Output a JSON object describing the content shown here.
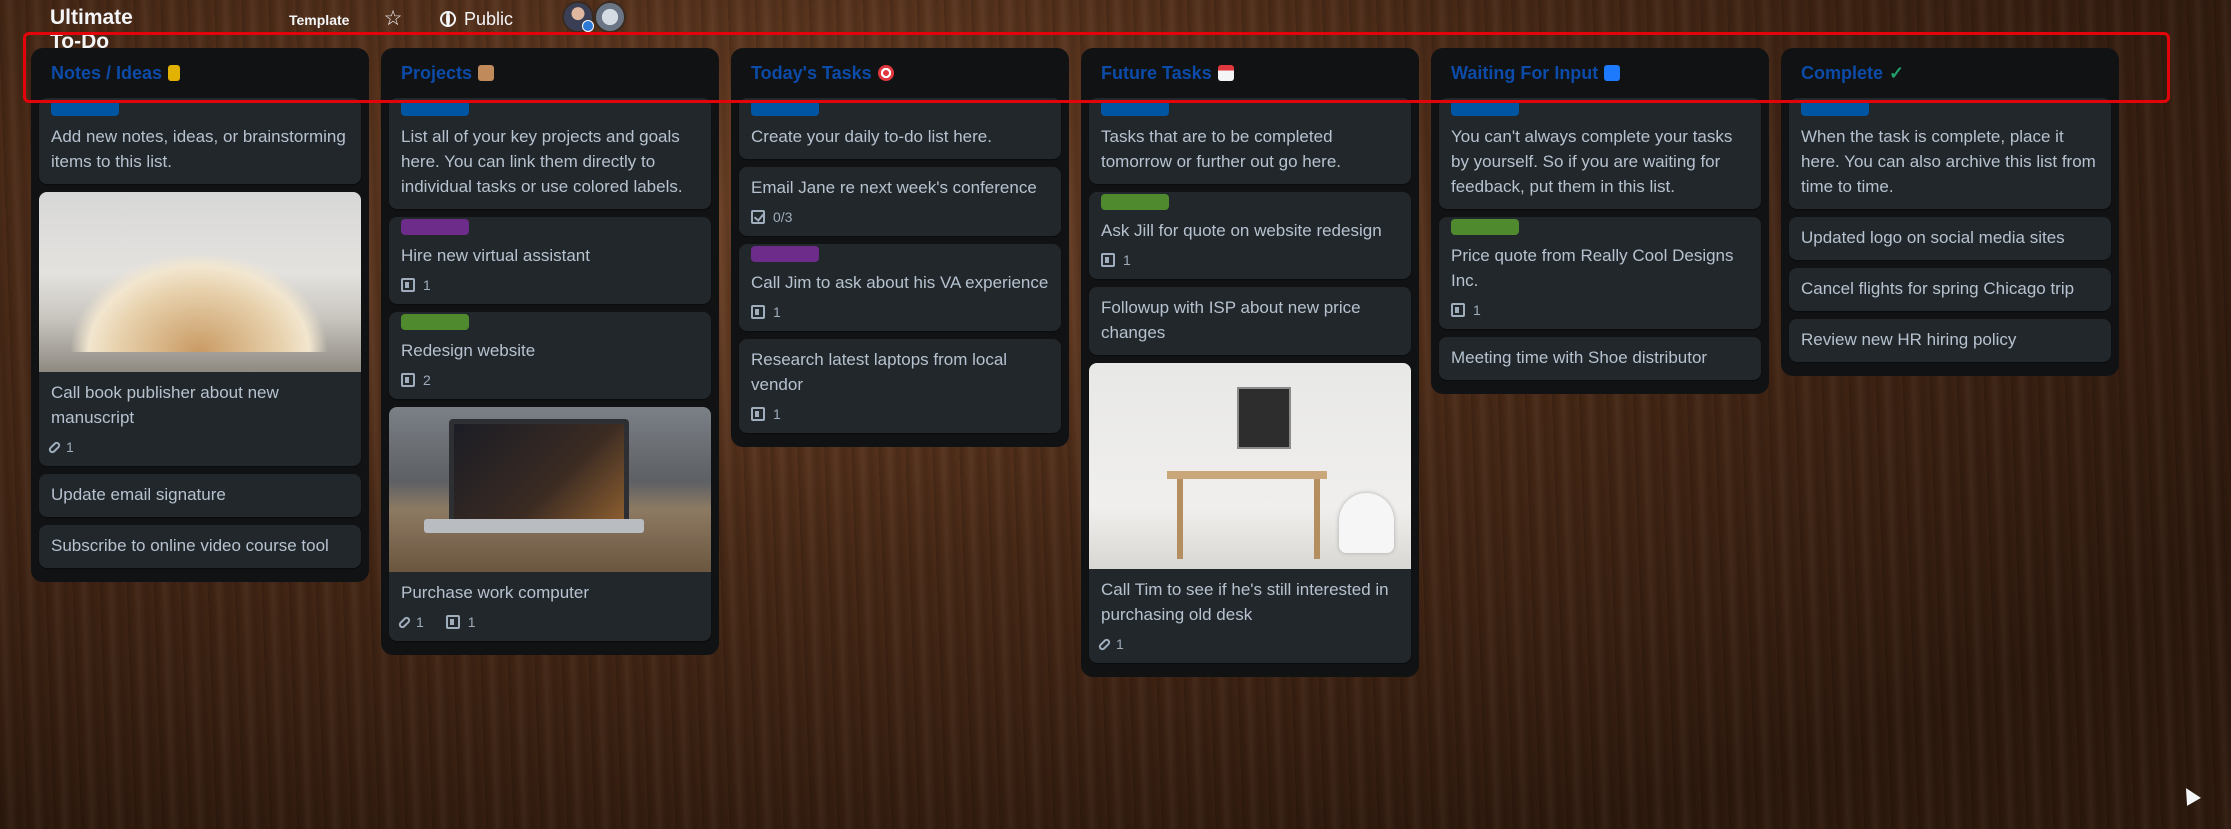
{
  "board": {
    "title": "Ultimate To-Do List",
    "template_badge": "Template",
    "visibility": "Public"
  },
  "colors": {
    "list_bg": "#101214",
    "card_bg": "#22272b",
    "card_text": "#b6c2cf",
    "list_title": "#0c4ba8",
    "highlight": "#e3030b",
    "label_blue": "#0055a3",
    "label_purple": "#6e2c8a",
    "label_green": "#4f8a2e"
  },
  "lists": [
    {
      "title": "Notes / Ideas",
      "emoji": "folder-emoji",
      "cards": [
        {
          "text": "Add new notes, ideas, or brainstorming items to this list.",
          "label": "blue"
        },
        {
          "text": "Call book publisher about new manuscript",
          "cover": "open-book-photo",
          "attachments": "1"
        },
        {
          "text": "Update email signature"
        },
        {
          "text": "Subscribe to online video course tool"
        }
      ]
    },
    {
      "title": "Projects",
      "emoji": "box-emoji",
      "cards": [
        {
          "text": "List all of your key projects and goals here. You can link them directly to individual tasks or use colored labels.",
          "label": "blue"
        },
        {
          "text": "Hire new virtual assistant",
          "label": "purple",
          "description": "1"
        },
        {
          "text": "Redesign website",
          "label": "green",
          "description": "2"
        },
        {
          "text": "Purchase work computer",
          "cover": "laptop-photo",
          "attachments": "1",
          "description": "1"
        }
      ]
    },
    {
      "title": "Today's Tasks",
      "emoji": "target-emoji",
      "cards": [
        {
          "text": "Create your daily to-do list here.",
          "label": "blue"
        },
        {
          "text": "Email Jane re next week's conference",
          "checklist": "0/3"
        },
        {
          "text": "Call Jim to ask about his VA experience",
          "label": "purple",
          "description": "1"
        },
        {
          "text": "Research latest laptops from local vendor",
          "description": "1"
        }
      ]
    },
    {
      "title": "Future Tasks",
      "emoji": "calendar-emoji",
      "cards": [
        {
          "text": "Tasks that are to be completed tomorrow or further out go here.",
          "label": "blue"
        },
        {
          "text": "Ask Jill for quote on website redesign",
          "label": "green",
          "description": "1"
        },
        {
          "text": "Followup with ISP about new price changes"
        },
        {
          "text": "Call Tim to see if he's still interested in purchasing old desk",
          "cover": "desk-photo",
          "attachments": "1"
        }
      ]
    },
    {
      "title": "Waiting For Input",
      "emoji": "pause-emoji",
      "cards": [
        {
          "text": "You can't always complete your tasks by yourself. So if you are waiting for feedback, put them in this list.",
          "label": "blue"
        },
        {
          "text": "Price quote from Really Cool Designs Inc.",
          "label": "green",
          "description": "1"
        },
        {
          "text": "Meeting time with Shoe distributor"
        }
      ]
    },
    {
      "title": "Complete",
      "emoji": "checkmark-emoji",
      "cards": [
        {
          "text": "When the task is complete, place it here. You can also archive this list from time to time.",
          "label": "blue"
        },
        {
          "text": "Updated logo on social media sites"
        },
        {
          "text": "Cancel flights for spring Chicago trip"
        },
        {
          "text": "Review new HR hiring policy"
        }
      ]
    }
  ]
}
